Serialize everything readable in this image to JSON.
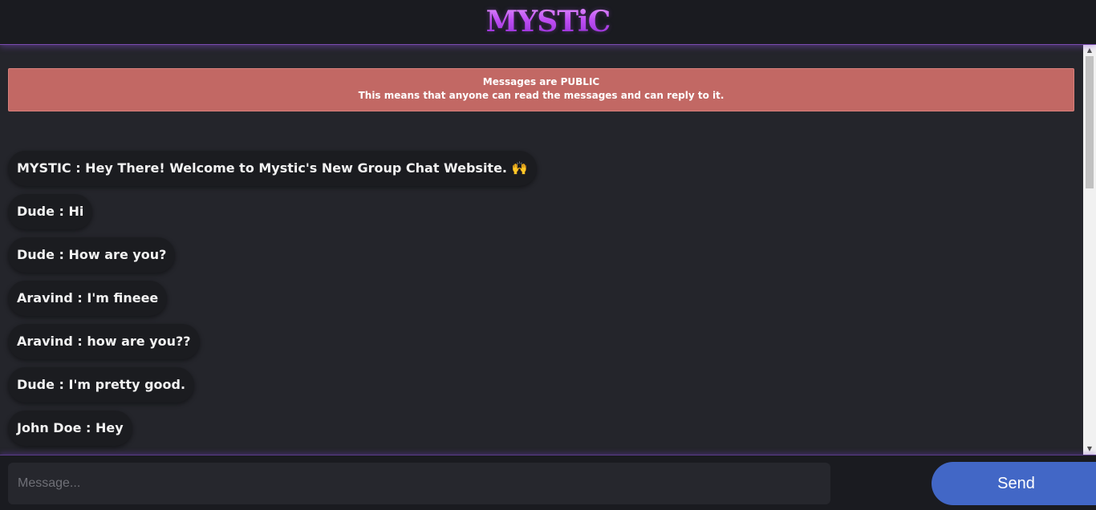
{
  "header": {
    "logo_text": "MYSTiC"
  },
  "notice": {
    "title": "Messages are PUBLIC",
    "text": "This means that anyone can read the messages and can reply to it."
  },
  "messages": [
    {
      "text": "MYSTIC : Hey There! Welcome to Mystic's New Group Chat Website. 🙌"
    },
    {
      "text": "Dude : Hi"
    },
    {
      "text": "Dude : How are you?"
    },
    {
      "text": "Aravind : I'm fineee"
    },
    {
      "text": "Aravind : how are you??"
    },
    {
      "text": "Dude : I'm pretty good."
    },
    {
      "text": "John Doe : Hey"
    }
  ],
  "composer": {
    "placeholder": "Message...",
    "value": "",
    "send_label": "Send"
  },
  "colors": {
    "background": "#24252b",
    "header": "#1a1b20",
    "notice": "#c26864",
    "bubble": "#1b1c20",
    "send_button": "#4267c6",
    "logo_accent": "#c44ff0"
  }
}
